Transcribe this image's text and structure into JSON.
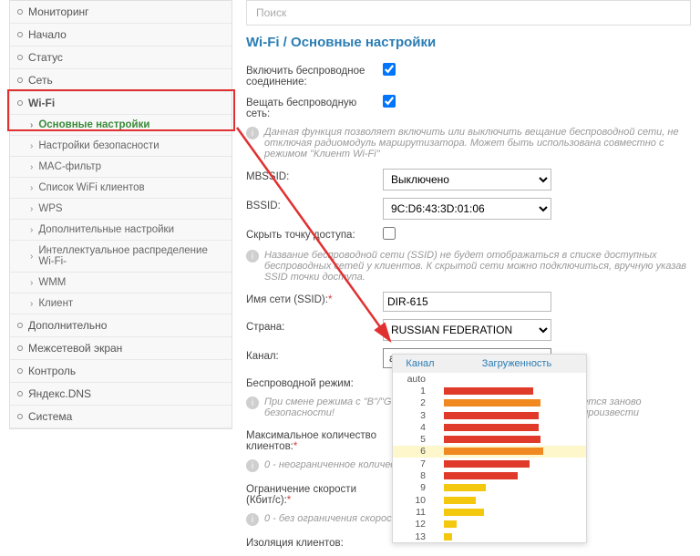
{
  "search": {
    "placeholder": "Поиск"
  },
  "breadcrumb": "Wi-Fi /  Основные настройки",
  "sidebar": {
    "items": [
      {
        "label": "Мониторинг",
        "type": "top"
      },
      {
        "label": "Начало",
        "type": "top"
      },
      {
        "label": "Статус",
        "type": "top"
      },
      {
        "label": "Сеть",
        "type": "top"
      },
      {
        "label": "Wi-Fi",
        "type": "top",
        "bold": true
      },
      {
        "label": "Основные настройки",
        "type": "sub",
        "active": true
      },
      {
        "label": "Настройки безопасности",
        "type": "sub"
      },
      {
        "label": "MAC-фильтр",
        "type": "sub"
      },
      {
        "label": "Список WiFi клиентов",
        "type": "sub"
      },
      {
        "label": "WPS",
        "type": "sub"
      },
      {
        "label": "Дополнительные настройки",
        "type": "sub"
      },
      {
        "label": "Интеллектуальное распределение Wi-Fi-",
        "type": "sub"
      },
      {
        "label": "WMM",
        "type": "sub"
      },
      {
        "label": "Клиент",
        "type": "sub"
      },
      {
        "label": "Дополнительно",
        "type": "top"
      },
      {
        "label": "Межсетевой экран",
        "type": "top"
      },
      {
        "label": "Контроль",
        "type": "top"
      },
      {
        "label": "Яндекс.DNS",
        "type": "top"
      },
      {
        "label": "Система",
        "type": "top"
      }
    ]
  },
  "form": {
    "enable_label": "Включить беспроводное соединение:",
    "broadcast_label": "Вещать беспроводную сеть:",
    "broadcast_hint": "Данная функция позволяет включить или выключить вещание беспроводной сети, не отключая радиомодуль маршрутизатора. Может быть использована совместно с режимом \"Клиент Wi-Fi\"",
    "mbssid_label": "MBSSID:",
    "mbssid_value": "Выключено",
    "bssid_label": "BSSID:",
    "bssid_value": "9C:D6:43:3D:01:06",
    "hide_label": "Скрыть точку доступа:",
    "hide_hint": "Название беспроводной сети (SSID) не будет отображаться в списке доступных беспроводных сетей у клиентов. К скрытой сети можно подключиться, вручную указав SSID точки доступа.",
    "ssid_label": "Имя сети (SSID):",
    "ssid_value": "DIR-615",
    "country_label": "Страна:",
    "country_value": "RUSSIAN FEDERATION",
    "channel_label": "Канал:",
    "channel_value": "auto",
    "mode_label": "Беспроводной режим:",
    "mode_hint": "При смене режима с \"B\"/\"G\" настройку безопасности!",
    "mode_hint_tail": "ется заново произвести",
    "maxclients_label": "Максимальное количество клиентов:",
    "maxclients_hint": "0 - неограниченное количес",
    "speed_label": "Ограничение скорости (Кбит/с):",
    "speed_hint": "0 - без ограничения скорост",
    "isolation_label": "Изоляция клиентов:"
  },
  "channel_dropdown": {
    "header_channel": "Канал",
    "header_load": "Загруженность",
    "rows": [
      {
        "label": "auto",
        "load": 0,
        "color": ""
      },
      {
        "label": "1",
        "load": 85,
        "color": "#e03a2a"
      },
      {
        "label": "2",
        "load": 92,
        "color": "#f08a20"
      },
      {
        "label": "3",
        "load": 90,
        "color": "#e03a2a"
      },
      {
        "label": "4",
        "load": 90,
        "color": "#e03a2a"
      },
      {
        "label": "5",
        "load": 92,
        "color": "#e03a2a"
      },
      {
        "label": "6",
        "load": 95,
        "color": "#f08a20",
        "selected": true
      },
      {
        "label": "7",
        "load": 82,
        "color": "#e03a2a"
      },
      {
        "label": "8",
        "load": 70,
        "color": "#e03a2a"
      },
      {
        "label": "9",
        "load": 40,
        "color": "#f4c80e"
      },
      {
        "label": "10",
        "load": 30,
        "color": "#f4c80e"
      },
      {
        "label": "11",
        "load": 38,
        "color": "#f4c80e"
      },
      {
        "label": "12",
        "load": 12,
        "color": "#f4c80e"
      },
      {
        "label": "13",
        "load": 8,
        "color": "#f4c80e"
      }
    ]
  },
  "chart_data": {
    "type": "bar",
    "title": "Загруженность",
    "xlabel": "Канал",
    "ylabel": "",
    "categories": [
      "1",
      "2",
      "3",
      "4",
      "5",
      "6",
      "7",
      "8",
      "9",
      "10",
      "11",
      "12",
      "13"
    ],
    "values": [
      85,
      92,
      90,
      90,
      92,
      95,
      82,
      70,
      40,
      30,
      38,
      12,
      8
    ],
    "ylim": [
      0,
      100
    ]
  }
}
